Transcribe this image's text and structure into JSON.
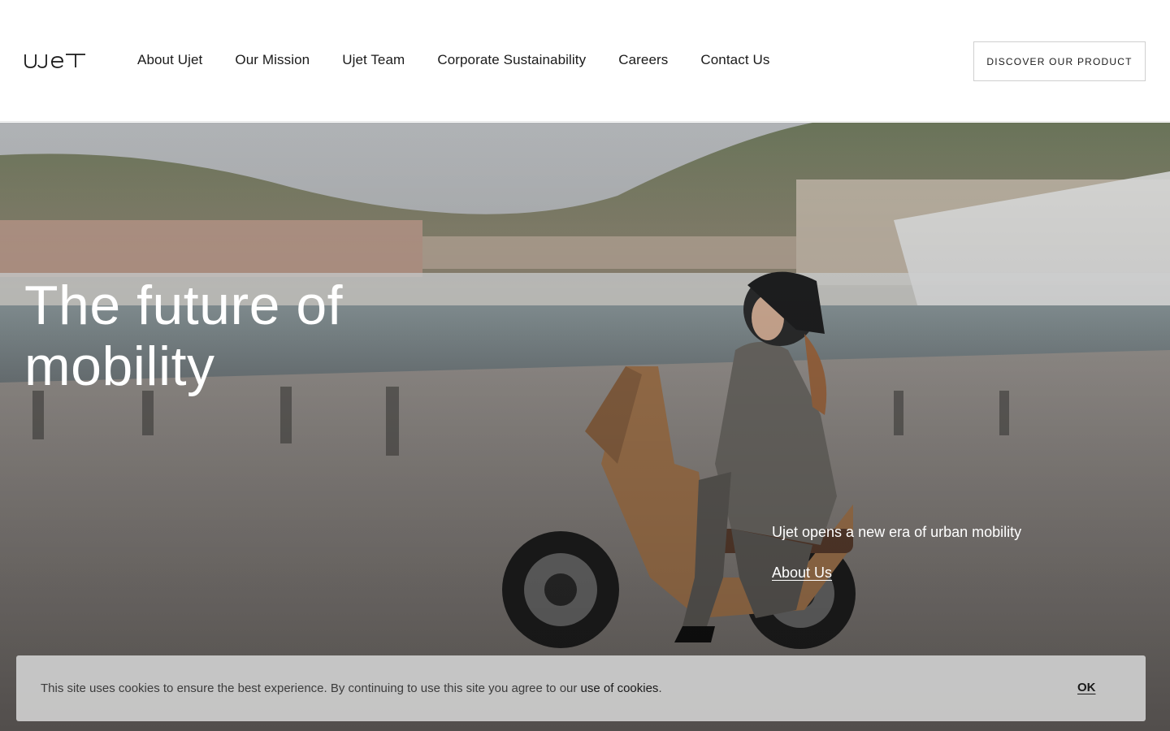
{
  "brand": {
    "logo_text": "UJET"
  },
  "nav": {
    "items": [
      {
        "label": "About Ujet"
      },
      {
        "label": "Our Mission"
      },
      {
        "label": "Ujet Team"
      },
      {
        "label": "Corporate Sustainability"
      },
      {
        "label": "Careers"
      },
      {
        "label": "Contact Us"
      }
    ],
    "cta_label": "DISCOVER OUR PRODUCT"
  },
  "hero": {
    "title": "The future of mobility",
    "subtitle": "Ujet opens a new era of urban mobility",
    "link_label": "About Us"
  },
  "cookie_banner": {
    "text": "This site uses cookies to ensure the best experience. By continuing to use this site you agree to our ",
    "link_label": "use of cookies",
    "text_end": ".",
    "ok_label": "OK"
  }
}
